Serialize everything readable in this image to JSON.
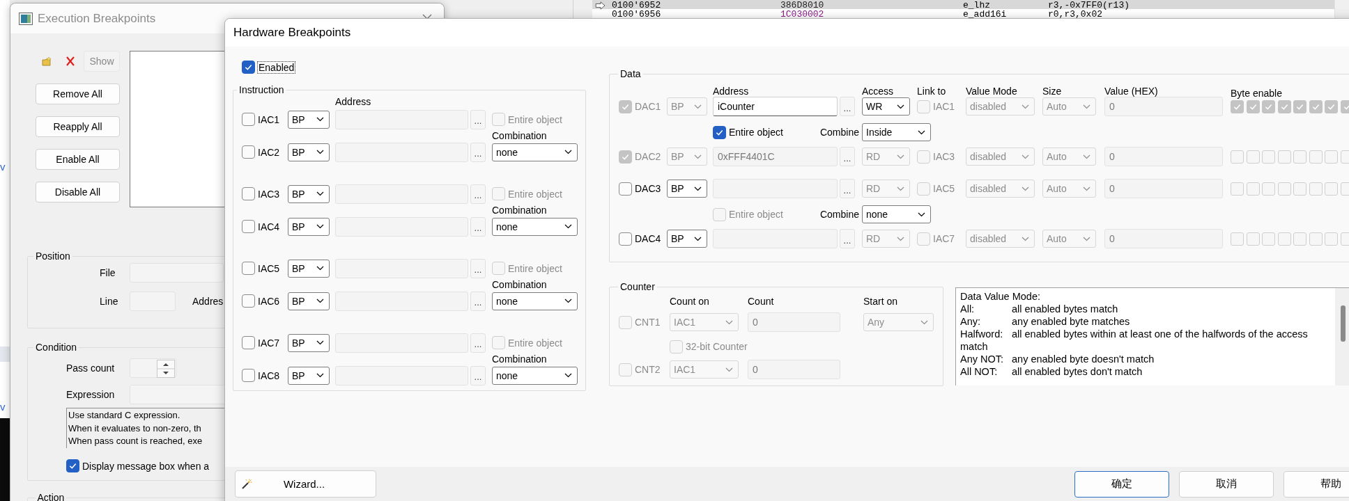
{
  "background": {
    "editor_fragments": [
      "v",
      "v"
    ],
    "disassembly": {
      "rows": [
        {
          "address": "0100'6952",
          "opcode": "386D8010",
          "mnemonic": "e_lhz",
          "operands": "r3,-0x7FF0(r13)",
          "selected": true,
          "current": true,
          "color": "#202020"
        },
        {
          "address": "0100'6956",
          "opcode": "1C030002",
          "mnemonic": "e_add16i",
          "operands": "r0,r3,0x02",
          "selected": false,
          "current": false,
          "color": "#8a1a8a"
        }
      ]
    }
  },
  "execution_breakpoints": {
    "title": "Execution Breakpoints",
    "show_button": {
      "label": "Show",
      "disabled": true
    },
    "buttons": [
      "Remove All",
      "Reapply All",
      "Enable All",
      "Disable All"
    ],
    "position": {
      "title": "Position",
      "file_label": "File",
      "line_label": "Line",
      "address_label": "Addres"
    },
    "condition": {
      "title": "Condition",
      "pass_count_label": "Pass count",
      "expression_label": "Expression",
      "help_lines": [
        "Use standard C expression.",
        "When it evaluates to non-zero, th",
        "When pass count is reached, exe"
      ],
      "message_box": {
        "label": "Display message box when a",
        "checked": true
      }
    },
    "action_title": "Action"
  },
  "hardware_breakpoints": {
    "title": "Hardware Breakpoints",
    "enabled": {
      "label": "Enabled",
      "checked": true
    },
    "instruction": {
      "title": "Instruction",
      "address_header": "Address",
      "pairs": [
        {
          "rows": [
            {
              "label": "IAC1",
              "checked": false,
              "type": "BP",
              "browse": "..."
            },
            {
              "label": "IAC2",
              "checked": false,
              "type": "BP",
              "browse": "..."
            }
          ],
          "entire_object": {
            "label": "Entire object",
            "checked": false,
            "disabled": true
          },
          "combination_label": "Combination",
          "combination": "none"
        },
        {
          "rows": [
            {
              "label": "IAC3",
              "checked": false,
              "type": "BP",
              "browse": "..."
            },
            {
              "label": "IAC4",
              "checked": false,
              "type": "BP",
              "browse": "..."
            }
          ],
          "entire_object": {
            "label": "Entire object",
            "checked": false,
            "disabled": true
          },
          "combination_label": "Combination",
          "combination": "none"
        },
        {
          "rows": [
            {
              "label": "IAC5",
              "checked": false,
              "type": "BP",
              "browse": "..."
            },
            {
              "label": "IAC6",
              "checked": false,
              "type": "BP",
              "browse": "..."
            }
          ],
          "entire_object": {
            "label": "Entire object",
            "checked": false,
            "disabled": true
          },
          "combination_label": "Combination",
          "combination": "none"
        },
        {
          "rows": [
            {
              "label": "IAC7",
              "checked": false,
              "type": "BP",
              "browse": "..."
            },
            {
              "label": "IAC8",
              "checked": false,
              "type": "BP",
              "browse": "..."
            }
          ],
          "entire_object": {
            "label": "Entire object",
            "checked": false,
            "disabled": true
          },
          "combination_label": "Combination",
          "combination": "none"
        }
      ]
    },
    "data": {
      "title": "Data",
      "columns": [
        "Address",
        "Access",
        "Link to",
        "Value Mode",
        "Size",
        "Value (HEX)",
        "Byte enable"
      ],
      "rows": [
        {
          "kind": "dac",
          "label": "DAC1",
          "checked": true,
          "disabled": true,
          "type": "BP",
          "type_disabled": true,
          "address": "iCounter",
          "address_disabled": false,
          "browse": "...",
          "access": "WR",
          "access_disabled": false,
          "link": {
            "label": "IAC1",
            "checked": false
          },
          "value_mode": "disabled",
          "size": "Auto",
          "value": "0",
          "byte_enable": [
            {
              "checked": true
            },
            {
              "checked": true
            },
            {
              "checked": true
            },
            {
              "checked": true
            },
            {
              "checked": true
            },
            {
              "checked": true
            },
            {
              "checked": true
            },
            {
              "checked": true
            }
          ]
        },
        {
          "kind": "options",
          "entire_object": {
            "label": "Entire object",
            "checked": true,
            "disabled": false
          },
          "combine_label": "Combine",
          "combine": "Inside"
        },
        {
          "kind": "dac",
          "label": "DAC2",
          "checked": true,
          "disabled": true,
          "type": "BP",
          "type_disabled": true,
          "address": "0xFFF4401C",
          "address_disabled": true,
          "browse": "...",
          "access": "RD",
          "access_disabled": true,
          "link": {
            "label": "IAC3",
            "checked": false
          },
          "value_mode": "disabled",
          "size": "Auto",
          "value": "0",
          "byte_enable": [
            {
              "checked": false
            },
            {
              "checked": false
            },
            {
              "checked": false
            },
            {
              "checked": false
            },
            {
              "checked": false
            },
            {
              "checked": false
            },
            {
              "checked": false
            },
            {
              "checked": false
            }
          ]
        },
        {
          "kind": "dac",
          "label": "DAC3",
          "checked": false,
          "disabled": false,
          "type": "BP",
          "type_disabled": false,
          "address_disabled": true,
          "browse": "...",
          "access": "RD",
          "access_disabled": true,
          "link": {
            "label": "IAC5",
            "checked": false
          },
          "value_mode": "disabled",
          "size": "Auto",
          "value": "0",
          "byte_enable": [
            {
              "checked": false
            },
            {
              "checked": false
            },
            {
              "checked": false
            },
            {
              "checked": false
            },
            {
              "checked": false
            },
            {
              "checked": false
            },
            {
              "checked": false
            },
            {
              "checked": false
            }
          ]
        },
        {
          "kind": "options",
          "entire_object": {
            "label": "Entire object",
            "checked": false,
            "disabled": true
          },
          "combine_label": "Combine",
          "combine": "none"
        },
        {
          "kind": "dac",
          "label": "DAC4",
          "checked": false,
          "disabled": false,
          "type": "BP",
          "type_disabled": false,
          "address_disabled": true,
          "browse": "...",
          "access": "RD",
          "access_disabled": true,
          "link": {
            "label": "IAC7",
            "checked": false
          },
          "value_mode": "disabled",
          "size": "Auto",
          "value": "0",
          "byte_enable": [
            {
              "checked": false
            },
            {
              "checked": false
            },
            {
              "checked": false
            },
            {
              "checked": false
            },
            {
              "checked": false
            },
            {
              "checked": false
            },
            {
              "checked": false
            },
            {
              "checked": false
            }
          ]
        }
      ]
    },
    "counter": {
      "title": "Counter",
      "columns": [
        "Count on",
        "Count",
        "Start on"
      ],
      "rows": [
        {
          "kind": "counter",
          "label": "CNT1",
          "checked": false,
          "disabled": true,
          "count_on": "IAC1",
          "count": "0",
          "start_on": "Any"
        },
        {
          "kind": "option",
          "text": "32-bit Counter",
          "checked": false,
          "disabled": true
        },
        {
          "kind": "counter",
          "label": "CNT2",
          "checked": false,
          "disabled": true,
          "count_on": "IAC1",
          "count": "0"
        }
      ]
    },
    "value_mode_help": {
      "heading": "Data Value Mode:",
      "entries": [
        {
          "term": "All:",
          "text": "all enabled bytes match"
        },
        {
          "term": "Any:",
          "text": "any enabled byte matches"
        },
        {
          "term": "Halfword:",
          "text": "all enabled bytes within at least one of the halfwords of the access match"
        },
        {
          "term": "Any NOT:",
          "text": "any enabled byte doesn't match"
        },
        {
          "term": "All NOT:",
          "text": "all enabled bytes don't match"
        }
      ]
    },
    "wizard": {
      "label": "Wizard..."
    },
    "buttons": [
      {
        "label": "确定",
        "default": true
      },
      {
        "label": "取消",
        "default": false
      },
      {
        "label": "帮助",
        "default": false
      }
    ]
  }
}
